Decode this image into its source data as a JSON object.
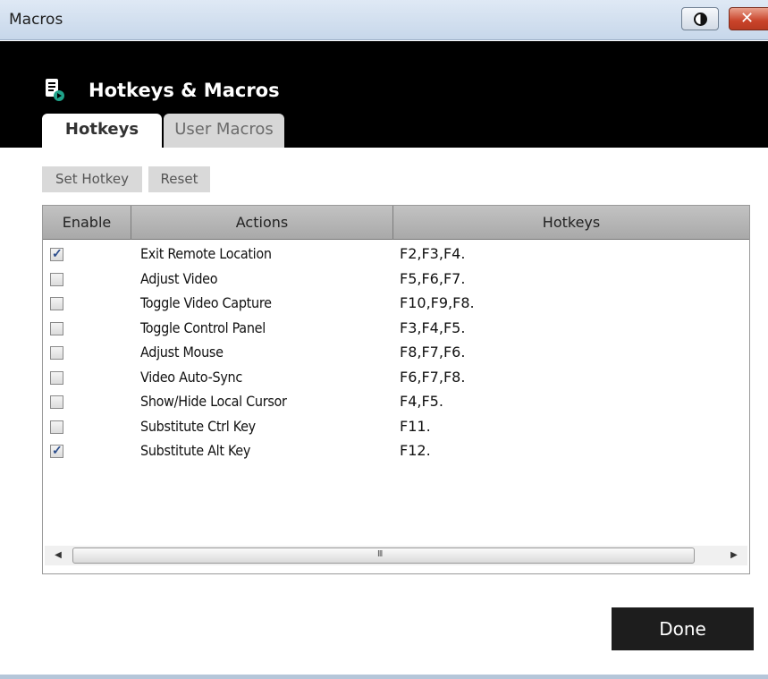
{
  "window": {
    "title": "Macros"
  },
  "titlebar": {
    "contrast_icon": "contrast-icon",
    "close_icon": "close-icon",
    "close_glyph": "✕"
  },
  "header": {
    "title": "Hotkeys & Macros",
    "icon": "document-gear-icon"
  },
  "tabs": [
    {
      "label": "Hotkeys",
      "active": true
    },
    {
      "label": "User Macros",
      "active": false
    }
  ],
  "toolbar": {
    "set_hotkey_label": "Set Hotkey",
    "reset_label": "Reset"
  },
  "table": {
    "columns": [
      "Enable",
      "Actions",
      "Hotkeys"
    ],
    "rows": [
      {
        "enabled": true,
        "action": "Exit Remote Location",
        "hotkey": "F2,F3,F4."
      },
      {
        "enabled": false,
        "action": "Adjust Video",
        "hotkey": "F5,F6,F7."
      },
      {
        "enabled": false,
        "action": "Toggle Video Capture",
        "hotkey": "F10,F9,F8."
      },
      {
        "enabled": false,
        "action": "Toggle Control Panel",
        "hotkey": "F3,F4,F5."
      },
      {
        "enabled": false,
        "action": "Adjust Mouse",
        "hotkey": "F8,F7,F6."
      },
      {
        "enabled": false,
        "action": "Video Auto-Sync",
        "hotkey": "F6,F7,F8."
      },
      {
        "enabled": false,
        "action": "Show/Hide Local Cursor",
        "hotkey": "F4,F5."
      },
      {
        "enabled": false,
        "action": "Substitute Ctrl Key",
        "hotkey": "F11."
      },
      {
        "enabled": true,
        "action": "Substitute Alt Key",
        "hotkey": "F12."
      }
    ]
  },
  "scrollbar": {
    "left_arrow": "◀",
    "right_arrow": "▶",
    "grip": "III"
  },
  "footer": {
    "done_label": "Done"
  },
  "colors": {
    "header_bg": "#000000",
    "done_bg": "#1d1d1d",
    "check_color": "#2d4e8c"
  }
}
